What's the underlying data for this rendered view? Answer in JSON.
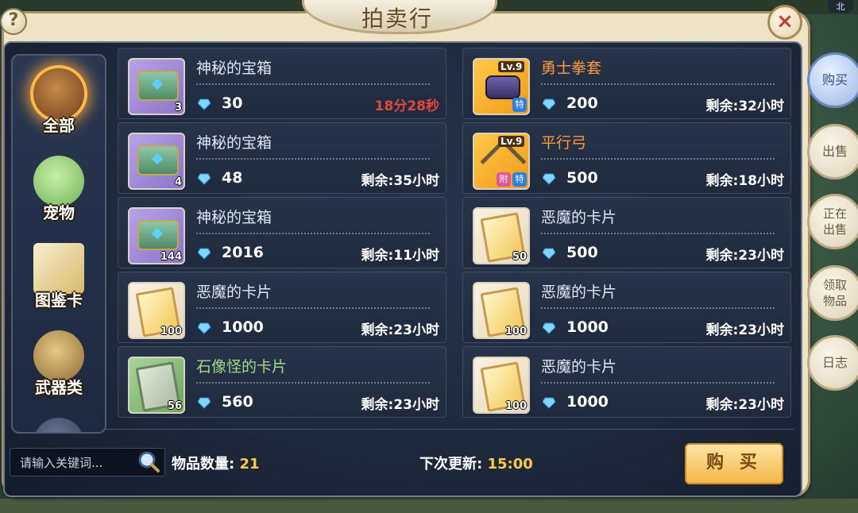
{
  "title": "拍卖行",
  "help_label": "?",
  "close_label": "×",
  "compass_label": "北",
  "categories": [
    {
      "label": "全部",
      "active": true
    },
    {
      "label": "宠物",
      "active": false
    },
    {
      "label": "图鉴卡",
      "active": false
    },
    {
      "label": "武器类",
      "active": false
    }
  ],
  "items": [
    {
      "name": "神秘的宝箱",
      "price": "30",
      "remain": "18分28秒",
      "qty": "3",
      "thumb": "chest"
    },
    {
      "name": "勇士拳套",
      "price": "200",
      "remain": "剩余:32小时",
      "level": "Lv.9",
      "tag": "特",
      "thumb": "glove"
    },
    {
      "name": "神秘的宝箱",
      "price": "48",
      "remain": "剩余:35小时",
      "qty": "4",
      "thumb": "chest"
    },
    {
      "name": "平行弓",
      "price": "500",
      "remain": "剩余:18小时",
      "level": "Lv.9",
      "tag": "特",
      "tag2": "附",
      "thumb": "bow"
    },
    {
      "name": "神秘的宝箱",
      "price": "2016",
      "remain": "剩余:11小时",
      "qty": "144",
      "thumb": "chest"
    },
    {
      "name": "恶魔的卡片",
      "price": "500",
      "remain": "剩余:23小时",
      "qty": "50",
      "thumb": "card"
    },
    {
      "name": "恶魔的卡片",
      "price": "1000",
      "remain": "剩余:23小时",
      "qty": "100",
      "thumb": "card"
    },
    {
      "name": "恶魔的卡片",
      "price": "1000",
      "remain": "剩余:23小时",
      "qty": "100",
      "thumb": "card"
    },
    {
      "name": "石像怪的卡片",
      "price": "560",
      "remain": "剩余:23小时",
      "qty": "56",
      "thumb": "stone-card"
    },
    {
      "name": "恶魔的卡片",
      "price": "1000",
      "remain": "剩余:23小时",
      "qty": "100",
      "thumb": "card"
    }
  ],
  "right_tabs": [
    {
      "label": "购买",
      "active": true
    },
    {
      "label": "出售",
      "active": false
    },
    {
      "label": "正在出售",
      "active": false
    },
    {
      "label": "领取物品",
      "active": false
    },
    {
      "label": "日志",
      "active": false
    }
  ],
  "search": {
    "placeholder": "请输入关键词..."
  },
  "count": {
    "label": "物品数量:",
    "value": "21"
  },
  "refresh": {
    "label": "下次更新:",
    "value": "15:00"
  },
  "buy_button": "购 买",
  "colors": {
    "accent": "#ffc94a",
    "remain_urgent": "#e0483a",
    "name_orange": "#ff9a3c",
    "name_green": "#9fd98a"
  }
}
